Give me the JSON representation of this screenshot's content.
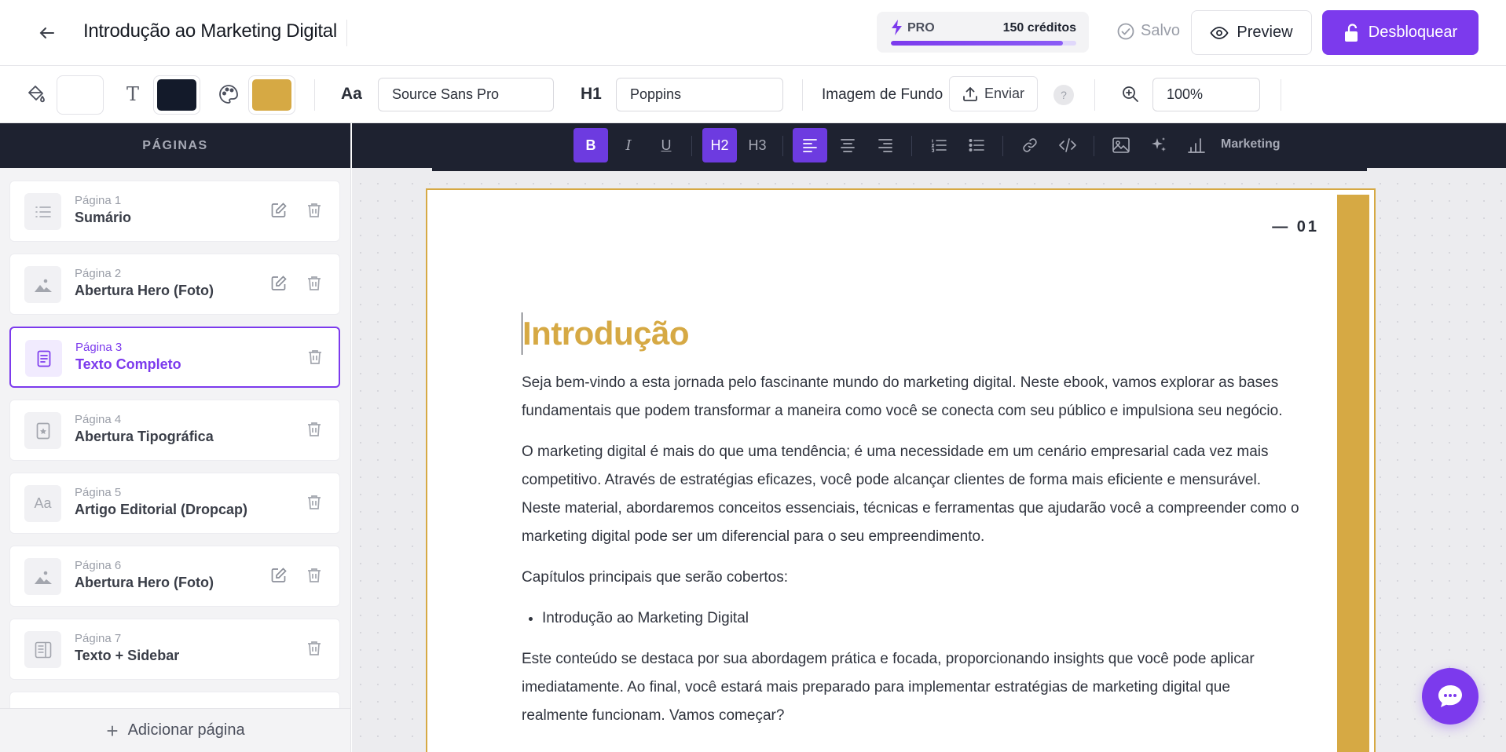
{
  "header": {
    "title": "Introdução ao Marketing Digital",
    "plan": "PRO",
    "credits": "150 créditos",
    "credits_fraction": 0.93,
    "saved_label": "Salvo",
    "preview_label": "Preview",
    "unlock_label": "Desbloquear"
  },
  "style_toolbar": {
    "background_color": "#ffffff",
    "text_color": "#131a2a",
    "accent_color": "#d6a944",
    "body_font_label": "Aa",
    "body_font": "Source Sans Pro",
    "heading_label": "H1",
    "heading_font": "Poppins",
    "background_image_label": "Imagem de Fundo",
    "upload_label": "Enviar",
    "help": "?",
    "zoom": "100%"
  },
  "sidebar": {
    "heading": "PÁGINAS",
    "pages": [
      {
        "number": "Página 1",
        "name": "Sumário"
      },
      {
        "number": "Página 2",
        "name": "Abertura Hero (Foto)"
      },
      {
        "number": "Página 3",
        "name": "Texto Completo"
      },
      {
        "number": "Página 4",
        "name": "Abertura Tipográfica"
      },
      {
        "number": "Página 5",
        "name": "Artigo Editorial (Dropcap)",
        "thumb": "Aa"
      },
      {
        "number": "Página 6",
        "name": "Abertura Hero (Foto)"
      },
      {
        "number": "Página 7",
        "name": "Texto + Sidebar"
      }
    ],
    "add_page_label": "Adicionar página"
  },
  "format_bar": {
    "bold": "B",
    "italic": "I",
    "underline": "U",
    "h2": "H2",
    "h3": "H3",
    "category": "Marketing"
  },
  "page": {
    "page_number": "— 01",
    "title": "Introdução",
    "paragraphs": [
      "Seja bem-vindo a esta jornada pelo fascinante mundo do marketing digital. Neste ebook, vamos explorar as bases fundamentais que podem transformar a maneira como você se conecta com seu público e impulsiona seu negócio.",
      "O marketing digital é mais do que uma tendência; é uma necessidade em um cenário empresarial cada vez mais competitivo. Através de estratégias eficazes, você pode alcançar clientes de forma mais eficiente e mensurável. Neste material, abordaremos conceitos essenciais, técnicas e ferramentas que ajudarão você a compreender como o marketing digital pode ser um diferencial para o seu empreendimento.",
      "Capítulos principais que serão cobertos:"
    ],
    "bullets": [
      "Introdução ao Marketing Digital"
    ],
    "closing": "Este conteúdo se destaca por sua abordagem prática e focada, proporcionando insights que você pode aplicar imediatamente. Ao final, você estará mais preparado para implementar estratégias de marketing digital que realmente funcionam. Vamos começar?"
  }
}
